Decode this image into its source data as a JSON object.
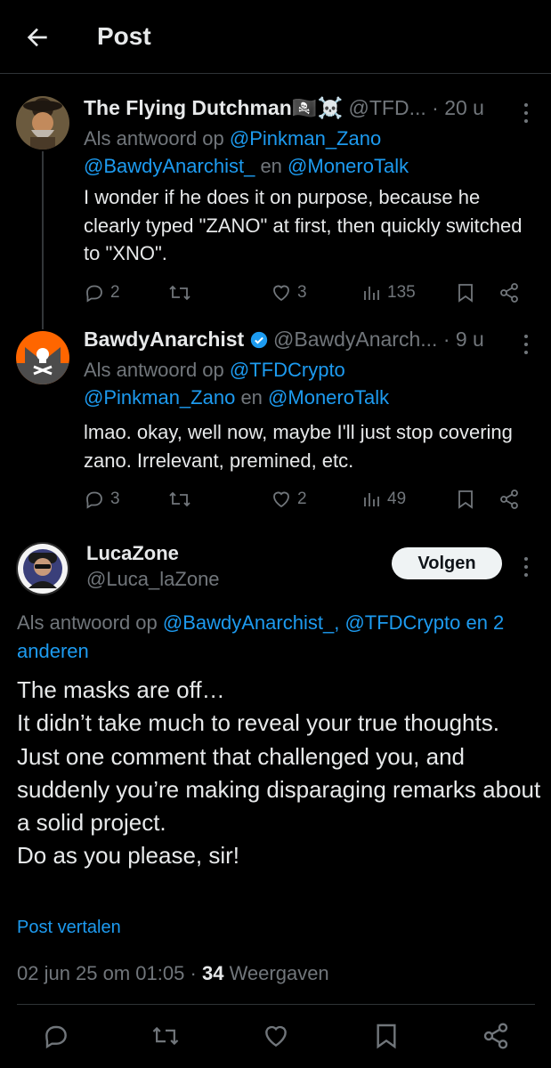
{
  "header": {
    "title": "Post"
  },
  "replies": [
    {
      "name": "The Flying Dutchman🏴‍☠️☠️",
      "handle": "@TFD...",
      "time": "· 20 u",
      "replyto_prefix": "Als antwoord op",
      "replyto_line1_link": "@Pinkman_Zano",
      "replyto_line2_a": "@BawdyAnarchist_",
      "replyto_line2_mid": "en",
      "replyto_line2_b": "@MoneroTalk",
      "text": "I wonder if he does it on purpose, because he clearly typed \"ZANO\" at first, then quickly switched to \"XNO\".",
      "replies": "2",
      "reposts": "",
      "likes": "3",
      "views": "135"
    },
    {
      "name": "BawdyAnarchist",
      "handle": "@BawdyAnarch...",
      "time": "· 9 u",
      "replyto_prefix": "Als antwoord op",
      "replyto_line1_link": "@TFDCrypto",
      "replyto_line2_a": "@Pinkman_Zano",
      "replyto_line2_mid": "en",
      "replyto_line2_b": "@MoneroTalk",
      "text": "lmao. okay, well now, maybe I'll just stop covering zano. Irrelevant, premined, etc.",
      "replies": "3",
      "reposts": "",
      "likes": "2",
      "views": "49"
    }
  ],
  "main": {
    "name": "LucaZone",
    "handle": "@Luca_laZone",
    "follow_label": "Volgen",
    "replyto_prefix": "Als antwoord op",
    "replyto_a": "@BawdyAnarchist_,",
    "replyto_b": "@TFDCrypto",
    "replyto_c": "en 2 anderen",
    "text": "The masks are off…\nIt didn’t take much to reveal your true thoughts.\nJust one comment that challenged you, and suddenly you’re making disparaging remarks about a solid project.\nDo as you please, sir!",
    "translate_label": "Post vertalen",
    "date": "02 jun 25 om 01:05",
    "sep": "·",
    "views_count": "34",
    "views_label": "Weergaven"
  },
  "colors": {
    "accent": "#1d9bf0",
    "muted": "#71767b",
    "text": "#e7e9ea",
    "bg": "#000000",
    "verified": "#1d9bf0"
  }
}
